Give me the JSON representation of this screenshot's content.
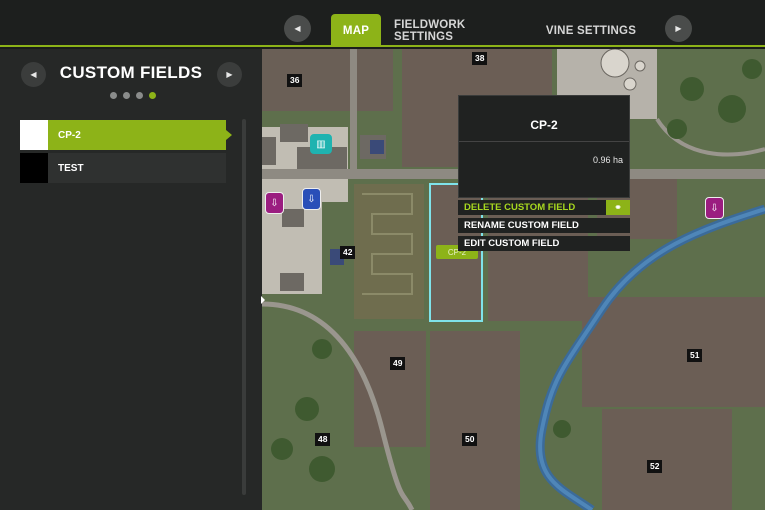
{
  "topbar": {
    "tabs": [
      {
        "label": "MAP",
        "active": true
      },
      {
        "label": "FIELDWORK SETTINGS",
        "active": false
      },
      {
        "label": "VINE SETTINGS",
        "active": false
      }
    ],
    "prev_icon": "chevron-left-icon",
    "next_icon": "chevron-right-icon",
    "accent_color": "#8db318"
  },
  "panel": {
    "title": "CUSTOM FIELDS",
    "page_dots": 4,
    "active_dot": 4,
    "fields": [
      {
        "name": "CP-2",
        "color": "#ffffff",
        "selected": true
      },
      {
        "name": "TEST",
        "color": "#000000",
        "selected": false
      }
    ]
  },
  "map": {
    "field_numbers": [
      "36",
      "38",
      "42",
      "49",
      "48",
      "50",
      "51",
      "52"
    ],
    "selected_field_tag": "CP-2",
    "poi_icons": [
      "sell-point-icon",
      "sell-point-icon",
      "sell-point-icon",
      "factory-icon",
      "sell-point-icon"
    ]
  },
  "popup": {
    "title": "CP-2",
    "area": "0.96 ha",
    "actions": [
      {
        "label": "DELETE CUSTOM FIELD",
        "highlight": true,
        "icon": "link-icon"
      },
      {
        "label": "RENAME CUSTOM FIELD"
      },
      {
        "label": "EDIT CUSTOM FIELD"
      }
    ]
  }
}
